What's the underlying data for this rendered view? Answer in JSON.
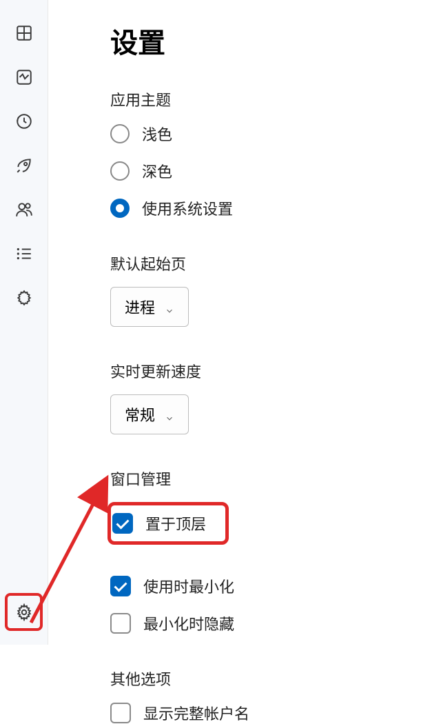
{
  "page": {
    "title": "设置"
  },
  "sections": {
    "theme": {
      "label": "应用主题",
      "options": {
        "light": "浅色",
        "dark": "深色",
        "system": "使用系统设置"
      },
      "selected": "system"
    },
    "start_page": {
      "label": "默认起始页",
      "value": "进程"
    },
    "update_speed": {
      "label": "实时更新速度",
      "value": "常规"
    },
    "window_mgmt": {
      "label": "窗口管理",
      "options": {
        "on_top": {
          "label": "置于顶层",
          "checked": true
        },
        "minimize_on_use": {
          "label": "使用时最小化",
          "checked": true
        },
        "hide_minimized": {
          "label": "最小化时隐藏",
          "checked": false
        }
      }
    },
    "other": {
      "label": "其他选项",
      "options": {
        "full_account": {
          "label": "显示完整帐户名",
          "checked": false
        }
      }
    }
  }
}
